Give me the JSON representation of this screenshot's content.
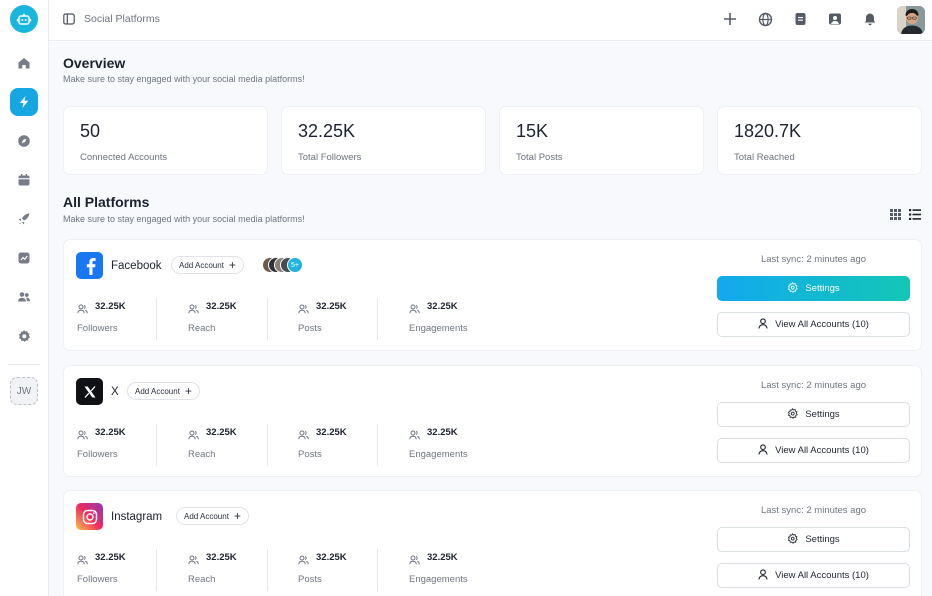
{
  "workspace": {
    "initials": "JW"
  },
  "header": {
    "breadcrumb": "Social Platforms"
  },
  "overview": {
    "title": "Overview",
    "subtitle": "Make sure to stay engaged with your social media platforms!",
    "stats": [
      {
        "value": "50",
        "label": "Connected Accounts"
      },
      {
        "value": "32.25K",
        "label": "Total Followers"
      },
      {
        "value": "15K",
        "label": "Total Posts"
      },
      {
        "value": "1820.7K",
        "label": "Total Reached"
      }
    ]
  },
  "platforms": {
    "title": "All Platforms",
    "subtitle": "Make sure to stay engaged with your social media platforms!",
    "add_label": "Add Account",
    "settings_label": "Settings",
    "view_all_label": "View All Accounts (10)",
    "items": [
      {
        "name": "Facebook",
        "sync": "Last sync: 2 minutes ago",
        "extra_accounts": "5+",
        "metrics": [
          {
            "value": "32.25K",
            "label": "Followers"
          },
          {
            "value": "32.25K",
            "label": "Reach"
          },
          {
            "value": "32.25K",
            "label": "Posts"
          },
          {
            "value": "32.25K",
            "label": "Engagements"
          }
        ]
      },
      {
        "name": "X",
        "sync": "Last sync: 2 minutes ago",
        "metrics": [
          {
            "value": "32.25K",
            "label": "Followers"
          },
          {
            "value": "32.25K",
            "label": "Reach"
          },
          {
            "value": "32.25K",
            "label": "Posts"
          },
          {
            "value": "32.25K",
            "label": "Engagements"
          }
        ]
      },
      {
        "name": "Instagram",
        "sync": "Last sync: 2 minutes ago",
        "metrics": [
          {
            "value": "32.25K",
            "label": "Followers"
          },
          {
            "value": "32.25K",
            "label": "Reach"
          },
          {
            "value": "32.25K",
            "label": "Posts"
          },
          {
            "value": "32.25K",
            "label": "Engagements"
          }
        ]
      }
    ]
  },
  "colors": {
    "accent": "#16a7e3",
    "gradient_start": "#12a9ef",
    "gradient_end": "#13c7b6",
    "facebook": "#1877f2"
  },
  "icons": [
    "robot-icon",
    "home-icon",
    "lightning-icon",
    "compass-icon",
    "calendar-icon",
    "rocket-icon",
    "chart-icon",
    "users-icon",
    "gear-icon",
    "sidebar-toggle-icon",
    "plus-icon",
    "globe-icon",
    "document-icon",
    "image-icon",
    "bell-icon",
    "grid-view-icon",
    "list-view-icon",
    "user-icon",
    "settings-icon"
  ]
}
